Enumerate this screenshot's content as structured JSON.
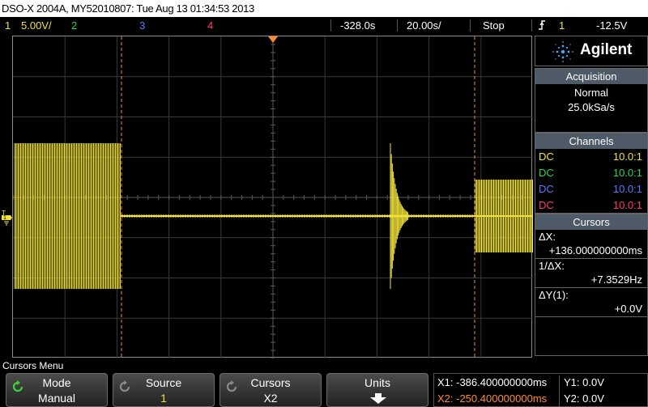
{
  "title": "DSO-X 2004A, MY52010807: Tue Aug 13 01:34:53 2013",
  "status": {
    "ch1_num": "1",
    "ch1_scale": "5.00V/",
    "ch2_num": "2",
    "ch3_num": "3",
    "ch4_num": "4",
    "delay": "-328.0s",
    "timebase": "20.00s/",
    "run_state": "Stop",
    "trigger_icon": "rising-edge-icon",
    "trigger_source": "1",
    "trigger_level": "-12.5V"
  },
  "colors": {
    "ch1": "#f0e23a",
    "ch2": "#33d14a",
    "ch3": "#5a78ff",
    "ch4": "#ff3a6a",
    "cursor": "#ff8a2a"
  },
  "brand": "Agilent",
  "acquisition": {
    "header": "Acquisition",
    "mode": "Normal",
    "rate": "25.0kSa/s"
  },
  "channels": {
    "header": "Channels",
    "rows": [
      {
        "coupling": "DC",
        "probe": "10.0:1"
      },
      {
        "coupling": "DC",
        "probe": "10.0:1"
      },
      {
        "coupling": "DC",
        "probe": "10.0:1"
      },
      {
        "coupling": "DC",
        "probe": "10.0:1"
      }
    ]
  },
  "cursors": {
    "header": "Cursors",
    "dx_label": "ΔX:",
    "dx_value": "+136.000000000ms",
    "inv_dx_label": "1/ΔX:",
    "inv_dx_value": "+7.3529Hz",
    "dy_label": "ΔY(1):",
    "dy_value": "+0.0V"
  },
  "menu": {
    "title": "Cursors Menu",
    "softkeys": [
      {
        "label": "Mode",
        "value": "Manual"
      },
      {
        "label": "Source",
        "value": "1"
      },
      {
        "label": "Cursors",
        "value": "X2"
      },
      {
        "label": "Units",
        "value": ""
      }
    ]
  },
  "readout": {
    "x1": "X1: -386.400000000ms",
    "x2": "X2: -250.400000000ms",
    "y1": "Y1: 0.0V",
    "y2": "Y2: 0.0V"
  },
  "markers": {
    "cursor_x1": "1",
    "cursor_x2": "X",
    "ground_label": "1"
  }
}
